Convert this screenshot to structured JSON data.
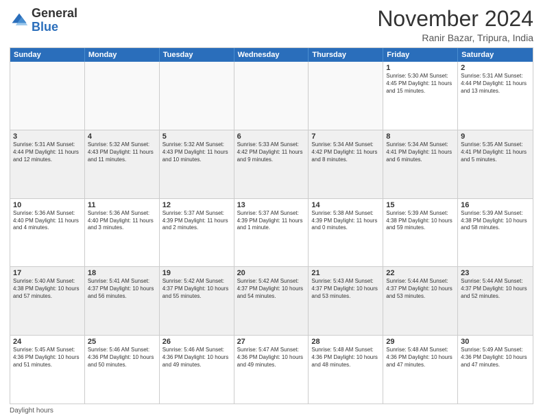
{
  "logo": {
    "general": "General",
    "blue": "Blue"
  },
  "title": "November 2024",
  "subtitle": "Ranir Bazar, Tripura, India",
  "header_days": [
    "Sunday",
    "Monday",
    "Tuesday",
    "Wednesday",
    "Thursday",
    "Friday",
    "Saturday"
  ],
  "footer": "Daylight hours",
  "rows": [
    [
      {
        "day": "",
        "text": "",
        "empty": true
      },
      {
        "day": "",
        "text": "",
        "empty": true
      },
      {
        "day": "",
        "text": "",
        "empty": true
      },
      {
        "day": "",
        "text": "",
        "empty": true
      },
      {
        "day": "",
        "text": "",
        "empty": true
      },
      {
        "day": "1",
        "text": "Sunrise: 5:30 AM\nSunset: 4:45 PM\nDaylight: 11 hours and 15 minutes."
      },
      {
        "day": "2",
        "text": "Sunrise: 5:31 AM\nSunset: 4:44 PM\nDaylight: 11 hours and 13 minutes."
      }
    ],
    [
      {
        "day": "3",
        "text": "Sunrise: 5:31 AM\nSunset: 4:44 PM\nDaylight: 11 hours and 12 minutes."
      },
      {
        "day": "4",
        "text": "Sunrise: 5:32 AM\nSunset: 4:43 PM\nDaylight: 11 hours and 11 minutes."
      },
      {
        "day": "5",
        "text": "Sunrise: 5:32 AM\nSunset: 4:43 PM\nDaylight: 11 hours and 10 minutes."
      },
      {
        "day": "6",
        "text": "Sunrise: 5:33 AM\nSunset: 4:42 PM\nDaylight: 11 hours and 9 minutes."
      },
      {
        "day": "7",
        "text": "Sunrise: 5:34 AM\nSunset: 4:42 PM\nDaylight: 11 hours and 8 minutes."
      },
      {
        "day": "8",
        "text": "Sunrise: 5:34 AM\nSunset: 4:41 PM\nDaylight: 11 hours and 6 minutes."
      },
      {
        "day": "9",
        "text": "Sunrise: 5:35 AM\nSunset: 4:41 PM\nDaylight: 11 hours and 5 minutes."
      }
    ],
    [
      {
        "day": "10",
        "text": "Sunrise: 5:36 AM\nSunset: 4:40 PM\nDaylight: 11 hours and 4 minutes."
      },
      {
        "day": "11",
        "text": "Sunrise: 5:36 AM\nSunset: 4:40 PM\nDaylight: 11 hours and 3 minutes."
      },
      {
        "day": "12",
        "text": "Sunrise: 5:37 AM\nSunset: 4:39 PM\nDaylight: 11 hours and 2 minutes."
      },
      {
        "day": "13",
        "text": "Sunrise: 5:37 AM\nSunset: 4:39 PM\nDaylight: 11 hours and 1 minute."
      },
      {
        "day": "14",
        "text": "Sunrise: 5:38 AM\nSunset: 4:39 PM\nDaylight: 11 hours and 0 minutes."
      },
      {
        "day": "15",
        "text": "Sunrise: 5:39 AM\nSunset: 4:38 PM\nDaylight: 10 hours and 59 minutes."
      },
      {
        "day": "16",
        "text": "Sunrise: 5:39 AM\nSunset: 4:38 PM\nDaylight: 10 hours and 58 minutes."
      }
    ],
    [
      {
        "day": "17",
        "text": "Sunrise: 5:40 AM\nSunset: 4:38 PM\nDaylight: 10 hours and 57 minutes."
      },
      {
        "day": "18",
        "text": "Sunrise: 5:41 AM\nSunset: 4:37 PM\nDaylight: 10 hours and 56 minutes."
      },
      {
        "day": "19",
        "text": "Sunrise: 5:42 AM\nSunset: 4:37 PM\nDaylight: 10 hours and 55 minutes."
      },
      {
        "day": "20",
        "text": "Sunrise: 5:42 AM\nSunset: 4:37 PM\nDaylight: 10 hours and 54 minutes."
      },
      {
        "day": "21",
        "text": "Sunrise: 5:43 AM\nSunset: 4:37 PM\nDaylight: 10 hours and 53 minutes."
      },
      {
        "day": "22",
        "text": "Sunrise: 5:44 AM\nSunset: 4:37 PM\nDaylight: 10 hours and 53 minutes."
      },
      {
        "day": "23",
        "text": "Sunrise: 5:44 AM\nSunset: 4:37 PM\nDaylight: 10 hours and 52 minutes."
      }
    ],
    [
      {
        "day": "24",
        "text": "Sunrise: 5:45 AM\nSunset: 4:36 PM\nDaylight: 10 hours and 51 minutes."
      },
      {
        "day": "25",
        "text": "Sunrise: 5:46 AM\nSunset: 4:36 PM\nDaylight: 10 hours and 50 minutes."
      },
      {
        "day": "26",
        "text": "Sunrise: 5:46 AM\nSunset: 4:36 PM\nDaylight: 10 hours and 49 minutes."
      },
      {
        "day": "27",
        "text": "Sunrise: 5:47 AM\nSunset: 4:36 PM\nDaylight: 10 hours and 49 minutes."
      },
      {
        "day": "28",
        "text": "Sunrise: 5:48 AM\nSunset: 4:36 PM\nDaylight: 10 hours and 48 minutes."
      },
      {
        "day": "29",
        "text": "Sunrise: 5:48 AM\nSunset: 4:36 PM\nDaylight: 10 hours and 47 minutes."
      },
      {
        "day": "30",
        "text": "Sunrise: 5:49 AM\nSunset: 4:36 PM\nDaylight: 10 hours and 47 minutes."
      }
    ]
  ]
}
